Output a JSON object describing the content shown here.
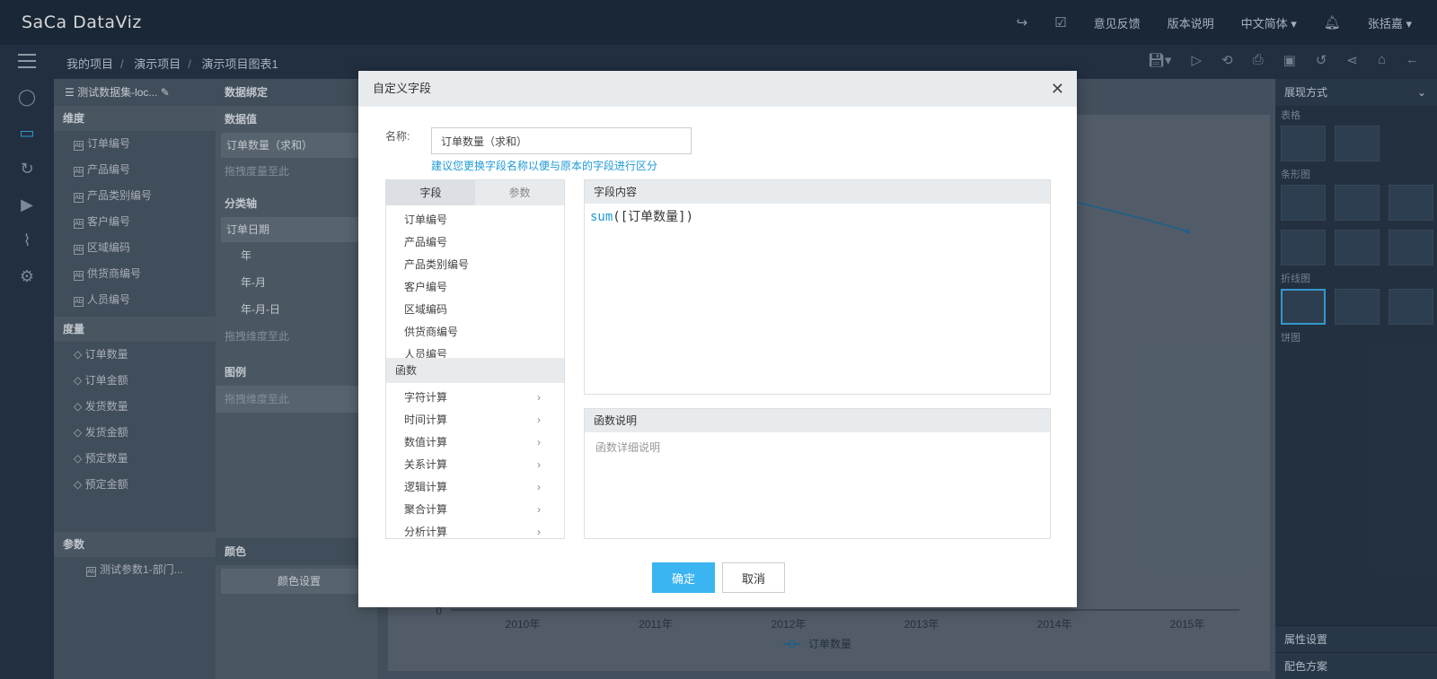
{
  "app": {
    "logo": "SaCa DataViz"
  },
  "topnav": {
    "feedback": "意见反馈",
    "version": "版本说明",
    "language": "中文简体",
    "user": "张括嘉"
  },
  "breadcrumb": [
    "我的项目",
    "演示项目",
    "演示项目图表1"
  ],
  "dataset": {
    "title": "测试数据集-loc...",
    "dim_title": "维度",
    "dimensions": [
      "订单编号",
      "产品编号",
      "产品类别编号",
      "客户编号",
      "区域编码",
      "供货商编号",
      "人员编号"
    ],
    "measure_title": "度量",
    "measures": [
      "订单数量",
      "订单金额",
      "发货数量",
      "发货金额",
      "预定数量",
      "预定金额"
    ],
    "param_title": "参数",
    "params": [
      "测试参数1-部门..."
    ]
  },
  "binding": {
    "title": "数据绑定",
    "value_title": "数据值",
    "value_field": "订单数量（求和）",
    "value_drop": "拖拽度量至此",
    "axis_title": "分类轴",
    "axis_field": "订单日期",
    "axis_options": [
      "年",
      "年-月",
      "年-月-日"
    ],
    "axis_drop": "拖拽维度至此",
    "legend_title": "图例",
    "legend_drop": "拖拽维度至此",
    "color_title": "颜色",
    "color_btn": "颜色设置"
  },
  "chart": {
    "x_labels": [
      "2010年",
      "2011年",
      "2012年",
      "2013年",
      "2014年",
      "2015年"
    ],
    "y_zero": "0",
    "legend": "订单数量"
  },
  "right_panel": {
    "title": "展现方式",
    "sections": [
      "表格",
      "条形图",
      "折线图",
      "饼图"
    ],
    "footer1": "属性设置",
    "footer2": "配色方案"
  },
  "modal": {
    "title": "自定义字段",
    "name_label": "名称:",
    "name_value": "订单数量（求和）",
    "hint": "建议您更换字段名称以便与原本的字段进行区分",
    "tab_fields": "字段",
    "tab_params": "参数",
    "fields": [
      "订单编号",
      "产品编号",
      "产品类别编号",
      "客户编号",
      "区域编码",
      "供货商编号",
      "人员编号"
    ],
    "func_title": "函数",
    "functions": [
      "字符计算",
      "时间计算",
      "数值计算",
      "关系计算",
      "逻辑计算",
      "聚合计算",
      "分析计算"
    ],
    "content_title": "字段内容",
    "code_fn": "sum",
    "code_arg": "([订单数量])",
    "desc_title": "函数说明",
    "desc_body": "函数详细说明",
    "ok": "确定",
    "cancel": "取消"
  }
}
